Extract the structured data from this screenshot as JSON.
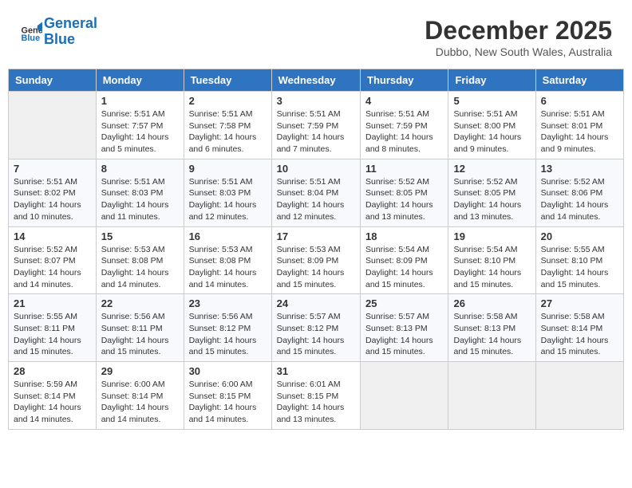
{
  "header": {
    "logo_line1": "General",
    "logo_line2": "Blue",
    "month": "December 2025",
    "location": "Dubbo, New South Wales, Australia"
  },
  "days_of_week": [
    "Sunday",
    "Monday",
    "Tuesday",
    "Wednesday",
    "Thursday",
    "Friday",
    "Saturday"
  ],
  "weeks": [
    [
      {
        "day": "",
        "sunrise": "",
        "sunset": "",
        "daylight": ""
      },
      {
        "day": "1",
        "sunrise": "Sunrise: 5:51 AM",
        "sunset": "Sunset: 7:57 PM",
        "daylight": "Daylight: 14 hours and 5 minutes."
      },
      {
        "day": "2",
        "sunrise": "Sunrise: 5:51 AM",
        "sunset": "Sunset: 7:58 PM",
        "daylight": "Daylight: 14 hours and 6 minutes."
      },
      {
        "day": "3",
        "sunrise": "Sunrise: 5:51 AM",
        "sunset": "Sunset: 7:59 PM",
        "daylight": "Daylight: 14 hours and 7 minutes."
      },
      {
        "day": "4",
        "sunrise": "Sunrise: 5:51 AM",
        "sunset": "Sunset: 7:59 PM",
        "daylight": "Daylight: 14 hours and 8 minutes."
      },
      {
        "day": "5",
        "sunrise": "Sunrise: 5:51 AM",
        "sunset": "Sunset: 8:00 PM",
        "daylight": "Daylight: 14 hours and 9 minutes."
      },
      {
        "day": "6",
        "sunrise": "Sunrise: 5:51 AM",
        "sunset": "Sunset: 8:01 PM",
        "daylight": "Daylight: 14 hours and 9 minutes."
      }
    ],
    [
      {
        "day": "7",
        "sunrise": "Sunrise: 5:51 AM",
        "sunset": "Sunset: 8:02 PM",
        "daylight": "Daylight: 14 hours and 10 minutes."
      },
      {
        "day": "8",
        "sunrise": "Sunrise: 5:51 AM",
        "sunset": "Sunset: 8:03 PM",
        "daylight": "Daylight: 14 hours and 11 minutes."
      },
      {
        "day": "9",
        "sunrise": "Sunrise: 5:51 AM",
        "sunset": "Sunset: 8:03 PM",
        "daylight": "Daylight: 14 hours and 12 minutes."
      },
      {
        "day": "10",
        "sunrise": "Sunrise: 5:51 AM",
        "sunset": "Sunset: 8:04 PM",
        "daylight": "Daylight: 14 hours and 12 minutes."
      },
      {
        "day": "11",
        "sunrise": "Sunrise: 5:52 AM",
        "sunset": "Sunset: 8:05 PM",
        "daylight": "Daylight: 14 hours and 13 minutes."
      },
      {
        "day": "12",
        "sunrise": "Sunrise: 5:52 AM",
        "sunset": "Sunset: 8:05 PM",
        "daylight": "Daylight: 14 hours and 13 minutes."
      },
      {
        "day": "13",
        "sunrise": "Sunrise: 5:52 AM",
        "sunset": "Sunset: 8:06 PM",
        "daylight": "Daylight: 14 hours and 14 minutes."
      }
    ],
    [
      {
        "day": "14",
        "sunrise": "Sunrise: 5:52 AM",
        "sunset": "Sunset: 8:07 PM",
        "daylight": "Daylight: 14 hours and 14 minutes."
      },
      {
        "day": "15",
        "sunrise": "Sunrise: 5:53 AM",
        "sunset": "Sunset: 8:08 PM",
        "daylight": "Daylight: 14 hours and 14 minutes."
      },
      {
        "day": "16",
        "sunrise": "Sunrise: 5:53 AM",
        "sunset": "Sunset: 8:08 PM",
        "daylight": "Daylight: 14 hours and 14 minutes."
      },
      {
        "day": "17",
        "sunrise": "Sunrise: 5:53 AM",
        "sunset": "Sunset: 8:09 PM",
        "daylight": "Daylight: 14 hours and 15 minutes."
      },
      {
        "day": "18",
        "sunrise": "Sunrise: 5:54 AM",
        "sunset": "Sunset: 8:09 PM",
        "daylight": "Daylight: 14 hours and 15 minutes."
      },
      {
        "day": "19",
        "sunrise": "Sunrise: 5:54 AM",
        "sunset": "Sunset: 8:10 PM",
        "daylight": "Daylight: 14 hours and 15 minutes."
      },
      {
        "day": "20",
        "sunrise": "Sunrise: 5:55 AM",
        "sunset": "Sunset: 8:10 PM",
        "daylight": "Daylight: 14 hours and 15 minutes."
      }
    ],
    [
      {
        "day": "21",
        "sunrise": "Sunrise: 5:55 AM",
        "sunset": "Sunset: 8:11 PM",
        "daylight": "Daylight: 14 hours and 15 minutes."
      },
      {
        "day": "22",
        "sunrise": "Sunrise: 5:56 AM",
        "sunset": "Sunset: 8:11 PM",
        "daylight": "Daylight: 14 hours and 15 minutes."
      },
      {
        "day": "23",
        "sunrise": "Sunrise: 5:56 AM",
        "sunset": "Sunset: 8:12 PM",
        "daylight": "Daylight: 14 hours and 15 minutes."
      },
      {
        "day": "24",
        "sunrise": "Sunrise: 5:57 AM",
        "sunset": "Sunset: 8:12 PM",
        "daylight": "Daylight: 14 hours and 15 minutes."
      },
      {
        "day": "25",
        "sunrise": "Sunrise: 5:57 AM",
        "sunset": "Sunset: 8:13 PM",
        "daylight": "Daylight: 14 hours and 15 minutes."
      },
      {
        "day": "26",
        "sunrise": "Sunrise: 5:58 AM",
        "sunset": "Sunset: 8:13 PM",
        "daylight": "Daylight: 14 hours and 15 minutes."
      },
      {
        "day": "27",
        "sunrise": "Sunrise: 5:58 AM",
        "sunset": "Sunset: 8:14 PM",
        "daylight": "Daylight: 14 hours and 15 minutes."
      }
    ],
    [
      {
        "day": "28",
        "sunrise": "Sunrise: 5:59 AM",
        "sunset": "Sunset: 8:14 PM",
        "daylight": "Daylight: 14 hours and 14 minutes."
      },
      {
        "day": "29",
        "sunrise": "Sunrise: 6:00 AM",
        "sunset": "Sunset: 8:14 PM",
        "daylight": "Daylight: 14 hours and 14 minutes."
      },
      {
        "day": "30",
        "sunrise": "Sunrise: 6:00 AM",
        "sunset": "Sunset: 8:15 PM",
        "daylight": "Daylight: 14 hours and 14 minutes."
      },
      {
        "day": "31",
        "sunrise": "Sunrise: 6:01 AM",
        "sunset": "Sunset: 8:15 PM",
        "daylight": "Daylight: 14 hours and 13 minutes."
      },
      {
        "day": "",
        "sunrise": "",
        "sunset": "",
        "daylight": ""
      },
      {
        "day": "",
        "sunrise": "",
        "sunset": "",
        "daylight": ""
      },
      {
        "day": "",
        "sunrise": "",
        "sunset": "",
        "daylight": ""
      }
    ]
  ]
}
